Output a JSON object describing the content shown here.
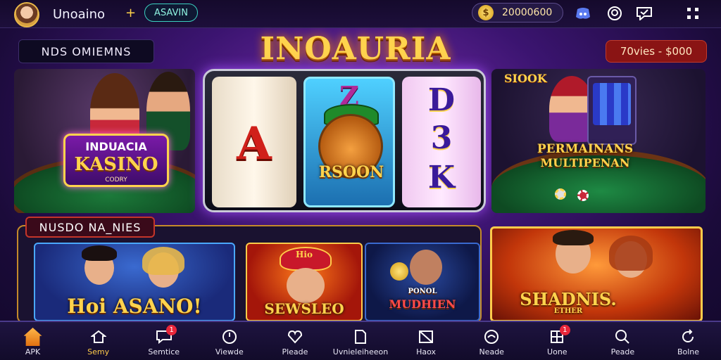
{
  "topbar": {
    "brand": "Unoaino",
    "plus": "+",
    "id_badge": "ASAVIN",
    "coins": "20000600",
    "coin_symbol": "$",
    "icons": [
      "discord-icon",
      "bell-icon",
      "chat-icon",
      "menu-icon"
    ]
  },
  "title": "INOAURIA",
  "left_tag": "NDS OMIEMNS",
  "right_tag": "70vies - $000",
  "kasino_card": {
    "line1": "INDUACIA",
    "line2": "KASINO",
    "line3": "CODRY"
  },
  "slot": {
    "reel1": "A",
    "reel2_top": "Z",
    "reel2_label": "RSOON",
    "reel3_top": "D",
    "reel3_mid": "3",
    "reel3_bottom": "K"
  },
  "multi_card": {
    "logo": "SIOOK",
    "line1": "PERMAINANS",
    "line2": "MULTIPENAN"
  },
  "section_label": "NUSDO NA_NIES",
  "games": [
    {
      "title": "Hoi ASANO!"
    },
    {
      "title": "SEWSLEO",
      "hat_text": "Hio"
    },
    {
      "title": "MUDHIEN",
      "sub": "PONOL"
    },
    {
      "title": "SHADNIS.",
      "sub": "ETHER"
    }
  ],
  "nav": [
    {
      "label": "APK",
      "icon": "home-icon",
      "active": false
    },
    {
      "label": "Semy",
      "icon": "house-outline-icon",
      "active": true
    },
    {
      "label": "Semtice",
      "icon": "chat-bubble-icon",
      "badge": "1"
    },
    {
      "label": "Viewde",
      "icon": "clock-icon"
    },
    {
      "label": "Pleade",
      "icon": "heart-icon"
    },
    {
      "label": "Uvnieleiheeon",
      "icon": "document-icon"
    },
    {
      "label": "Haox",
      "icon": "box-icon"
    },
    {
      "label": "Neade",
      "icon": "circle-icon"
    },
    {
      "label": "Uone",
      "icon": "grid-icon",
      "badge": "1"
    },
    {
      "label": "Peade",
      "icon": "search-icon"
    },
    {
      "label": "Bolne",
      "icon": "refresh-icon"
    }
  ],
  "colors": {
    "gold": "#ffd34d",
    "accent_teal": "#3ad0c0",
    "badge_red": "#e8263a"
  }
}
